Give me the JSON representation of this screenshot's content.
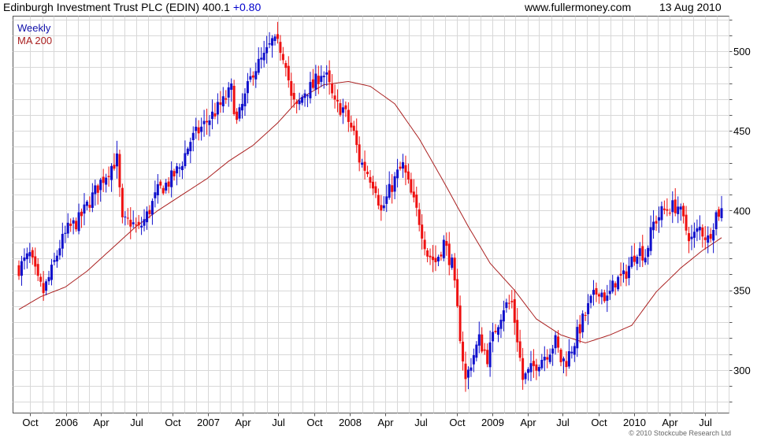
{
  "header": {
    "security": "Edinburgh Investment Trust PLC (EDIN)",
    "price": "400.1",
    "change": "+0.80",
    "site": "www.fullermoney.com",
    "date": "13 Aug 2010"
  },
  "legend": {
    "period": "Weekly",
    "ma": "MA 200"
  },
  "footer": "© 2010 Stockcube Research Ltd",
  "colors": {
    "up": "#1010cc",
    "down": "#ee1111",
    "ma": "#aa2020",
    "grid": "#d8d8d8",
    "change": "#0000cc"
  },
  "chart_data": {
    "type": "ohlc",
    "ylim": [
      273,
      522
    ],
    "yticks": [
      300,
      350,
      400,
      450,
      500
    ],
    "x_start": "2005-09-02",
    "x_end": "2010-08-13",
    "x_ticks": [
      {
        "label": "Oct",
        "date": "2005-10-01"
      },
      {
        "label": "2006",
        "date": "2006-01-01"
      },
      {
        "label": "Apr",
        "date": "2006-04-01"
      },
      {
        "label": "Jul",
        "date": "2006-07-01"
      },
      {
        "label": "Oct",
        "date": "2006-10-01"
      },
      {
        "label": "2007",
        "date": "2007-01-01"
      },
      {
        "label": "Apr",
        "date": "2007-04-01"
      },
      {
        "label": "Jul",
        "date": "2007-07-01"
      },
      {
        "label": "Oct",
        "date": "2007-10-01"
      },
      {
        "label": "2008",
        "date": "2008-01-01"
      },
      {
        "label": "Apr",
        "date": "2008-04-01"
      },
      {
        "label": "Jul",
        "date": "2008-07-01"
      },
      {
        "label": "Oct",
        "date": "2008-10-01"
      },
      {
        "label": "2009",
        "date": "2009-01-01"
      },
      {
        "label": "Apr",
        "date": "2009-04-01"
      },
      {
        "label": "Jul",
        "date": "2009-07-01"
      },
      {
        "label": "Oct",
        "date": "2009-10-01"
      },
      {
        "label": "2010",
        "date": "2010-01-01"
      },
      {
        "label": "Apr",
        "date": "2010-04-01"
      },
      {
        "label": "Jul",
        "date": "2010-07-01"
      }
    ],
    "price_path": [
      [
        "2005-09-02",
        364
      ],
      [
        "2005-09-30",
        372
      ],
      [
        "2005-10-21",
        355
      ],
      [
        "2005-11-04",
        349
      ],
      [
        "2005-11-25",
        362
      ],
      [
        "2005-12-16",
        378
      ],
      [
        "2006-01-06",
        388
      ],
      [
        "2006-02-03",
        394
      ],
      [
        "2006-03-03",
        406
      ],
      [
        "2006-03-31",
        418
      ],
      [
        "2006-04-28",
        428
      ],
      [
        "2006-05-12",
        432
      ],
      [
        "2006-05-26",
        392
      ],
      [
        "2006-06-16",
        393
      ],
      [
        "2006-07-07",
        388
      ],
      [
        "2006-07-28",
        397
      ],
      [
        "2006-08-25",
        412
      ],
      [
        "2006-09-22",
        418
      ],
      [
        "2006-10-20",
        427
      ],
      [
        "2006-11-17",
        444
      ],
      [
        "2006-12-15",
        452
      ],
      [
        "2007-01-12",
        460
      ],
      [
        "2007-02-09",
        468
      ],
      [
        "2007-03-02",
        476
      ],
      [
        "2007-03-16",
        455
      ],
      [
        "2007-04-06",
        471
      ],
      [
        "2007-04-27",
        488
      ],
      [
        "2007-05-25",
        496
      ],
      [
        "2007-06-15",
        506
      ],
      [
        "2007-07-06",
        502
      ],
      [
        "2007-07-20",
        494
      ],
      [
        "2007-08-03",
        470
      ],
      [
        "2007-08-17",
        464
      ],
      [
        "2007-09-07",
        475
      ],
      [
        "2007-09-28",
        478
      ],
      [
        "2007-10-19",
        487
      ],
      [
        "2007-11-02",
        483
      ],
      [
        "2007-11-23",
        466
      ],
      [
        "2007-12-14",
        464
      ],
      [
        "2008-01-11",
        448
      ],
      [
        "2008-01-25",
        432
      ],
      [
        "2008-02-15",
        424
      ],
      [
        "2008-03-07",
        415
      ],
      [
        "2008-03-21",
        399
      ],
      [
        "2008-04-11",
        412
      ],
      [
        "2008-05-02",
        423
      ],
      [
        "2008-05-16",
        428
      ],
      [
        "2008-06-06",
        410
      ],
      [
        "2008-06-27",
        394
      ],
      [
        "2008-07-18",
        373
      ],
      [
        "2008-08-08",
        368
      ],
      [
        "2008-08-29",
        380
      ],
      [
        "2008-09-19",
        366
      ],
      [
        "2008-10-10",
        322
      ],
      [
        "2008-10-24",
        293
      ],
      [
        "2008-11-07",
        305
      ],
      [
        "2008-11-28",
        319
      ],
      [
        "2008-12-19",
        308
      ],
      [
        "2009-01-09",
        326
      ],
      [
        "2009-01-30",
        340
      ],
      [
        "2009-02-20",
        342
      ],
      [
        "2009-03-06",
        320
      ],
      [
        "2009-03-20",
        294
      ],
      [
        "2009-04-10",
        300
      ],
      [
        "2009-05-01",
        306
      ],
      [
        "2009-05-22",
        311
      ],
      [
        "2009-06-12",
        318
      ],
      [
        "2009-06-26",
        306
      ],
      [
        "2009-07-10",
        306
      ],
      [
        "2009-07-31",
        318
      ],
      [
        "2009-08-21",
        331
      ],
      [
        "2009-09-11",
        343
      ],
      [
        "2009-10-02",
        351
      ],
      [
        "2009-10-23",
        344
      ],
      [
        "2009-11-13",
        356
      ],
      [
        "2009-12-04",
        358
      ],
      [
        "2010-01-08",
        376
      ],
      [
        "2010-01-29",
        372
      ],
      [
        "2010-02-19",
        392
      ],
      [
        "2010-03-12",
        399
      ],
      [
        "2010-04-02",
        402
      ],
      [
        "2010-04-23",
        403
      ],
      [
        "2010-05-14",
        388
      ],
      [
        "2010-05-28",
        382
      ],
      [
        "2010-06-18",
        389
      ],
      [
        "2010-07-09",
        382
      ],
      [
        "2010-07-30",
        398
      ],
      [
        "2010-08-13",
        400.1
      ]
    ],
    "ma_path": [
      [
        "2005-09-02",
        338
      ],
      [
        "2005-10-28",
        346
      ],
      [
        "2005-12-30",
        352
      ],
      [
        "2006-02-24",
        362
      ],
      [
        "2006-04-28",
        376
      ],
      [
        "2006-06-30",
        390
      ],
      [
        "2006-08-25",
        400
      ],
      [
        "2006-10-27",
        410
      ],
      [
        "2006-12-29",
        420
      ],
      [
        "2007-02-23",
        431
      ],
      [
        "2007-04-27",
        441
      ],
      [
        "2007-06-29",
        455
      ],
      [
        "2007-08-24",
        470
      ],
      [
        "2007-10-26",
        479
      ],
      [
        "2007-12-28",
        481
      ],
      [
        "2008-02-22",
        478
      ],
      [
        "2008-04-25",
        467
      ],
      [
        "2008-06-27",
        445
      ],
      [
        "2008-08-29",
        418
      ],
      [
        "2008-10-31",
        390
      ],
      [
        "2008-12-26",
        367
      ],
      [
        "2009-02-27",
        350
      ],
      [
        "2009-04-24",
        332
      ],
      [
        "2009-06-26",
        322
      ],
      [
        "2009-08-28",
        317
      ],
      [
        "2009-10-30",
        322
      ],
      [
        "2009-12-25",
        328
      ],
      [
        "2010-02-26",
        349
      ],
      [
        "2010-04-30",
        364
      ],
      [
        "2010-06-25",
        375
      ],
      [
        "2010-08-13",
        383
      ]
    ]
  }
}
